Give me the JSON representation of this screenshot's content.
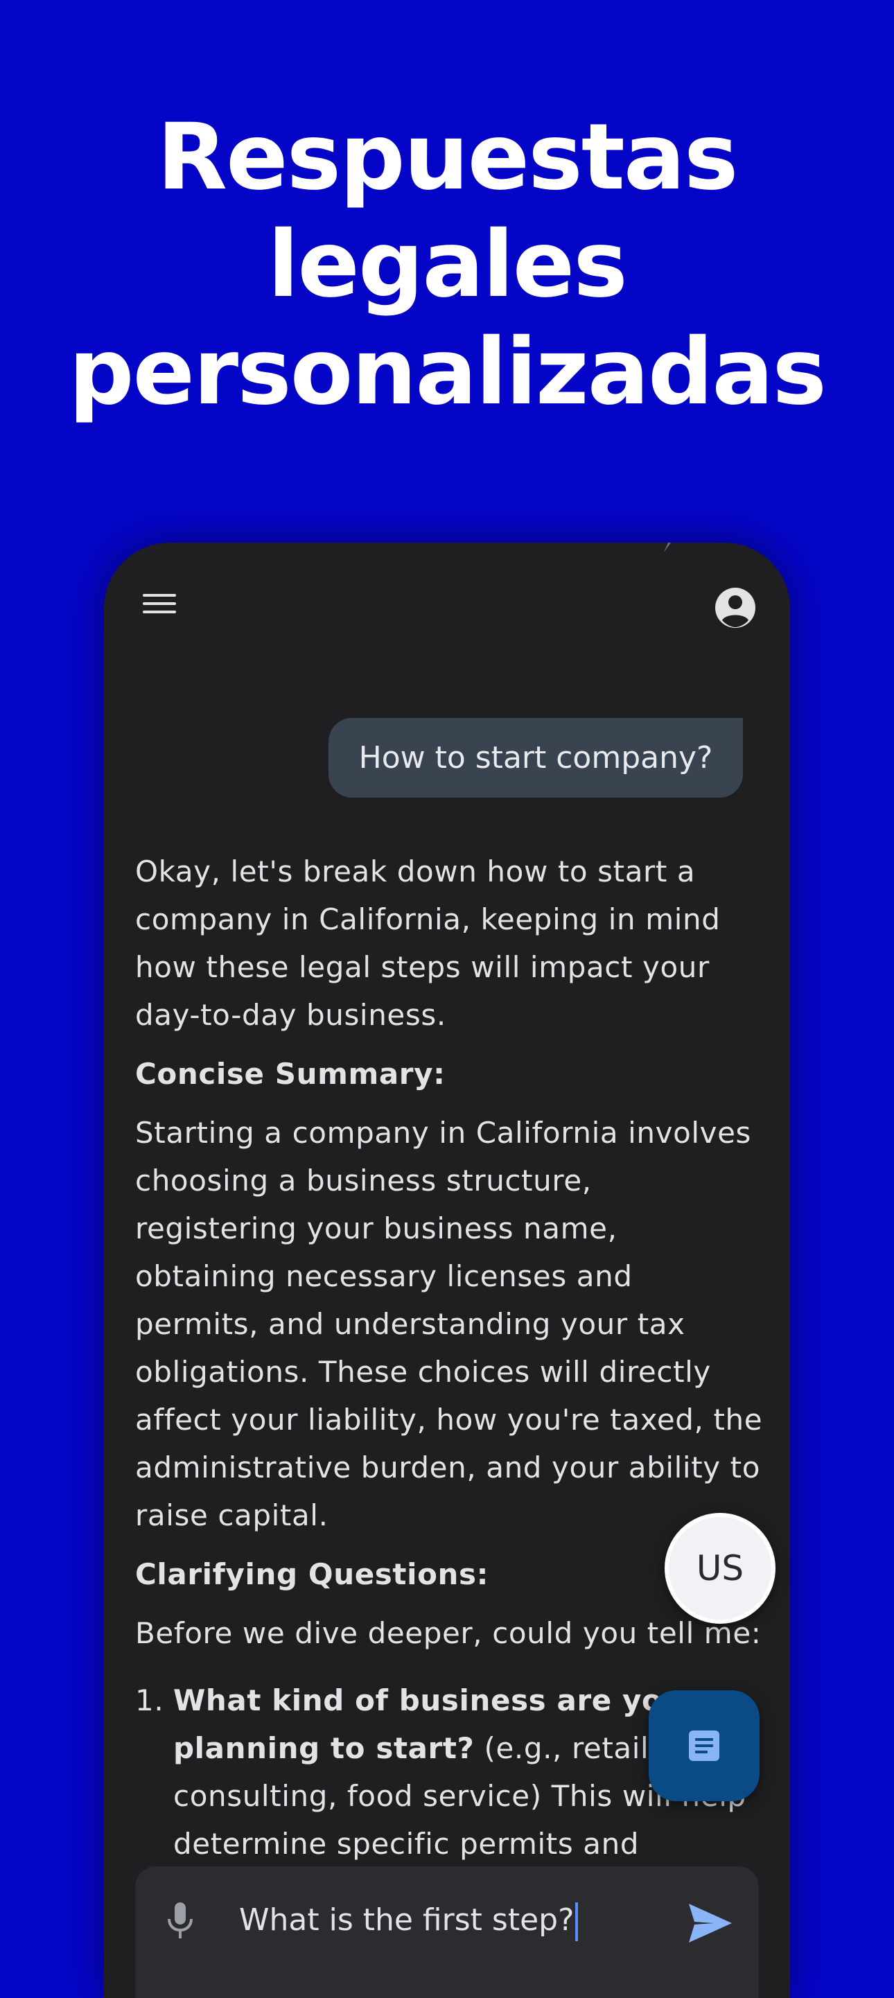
{
  "headline": {
    "lines": [
      "Respuestas",
      "legales",
      "personalizadas"
    ]
  },
  "conversation": {
    "user_message": "How to start company?",
    "intro": [
      "Okay, let's break down how to start a",
      "company in California, keeping in mind",
      "how these legal steps will impact your",
      "day-to-day business."
    ],
    "summary_heading": "Concise Summary:",
    "summary_lines": [
      "Starting a company in California involves",
      "choosing a business structure,",
      "registering your business name,",
      "obtaining necessary licenses and",
      "permits, and understanding your tax",
      "obligations. These choices will directly",
      "affect your liability, how you're taxed, the",
      "administrative burden, and your ability to",
      "raise capital."
    ],
    "questions_heading": "Clarifying Questions:",
    "questions_intro": "Before we dive deeper, could you tell me:",
    "list_item_1": {
      "number": "1.",
      "line1_bold": "What kind of business are you",
      "line2_bold": "planning to start?",
      "line2_rest": " (e.g., retail, te",
      "line3": "consulting, food service) This will help",
      "line4": "determine specific permits and"
    }
  },
  "region_button": {
    "label": "US"
  },
  "input": {
    "value": "What is the first step?"
  },
  "icons": {
    "menu": "menu-icon",
    "profile": "account-circle-icon",
    "documents": "document-icon",
    "mic": "mic-icon",
    "send": "send-icon"
  },
  "colors": {
    "background": "#0505c8",
    "phone_surface": "#1f1f21",
    "user_bubble": "#3a4350",
    "doc_fab": "#0a4b86",
    "send_accent": "#8ab4f8"
  }
}
